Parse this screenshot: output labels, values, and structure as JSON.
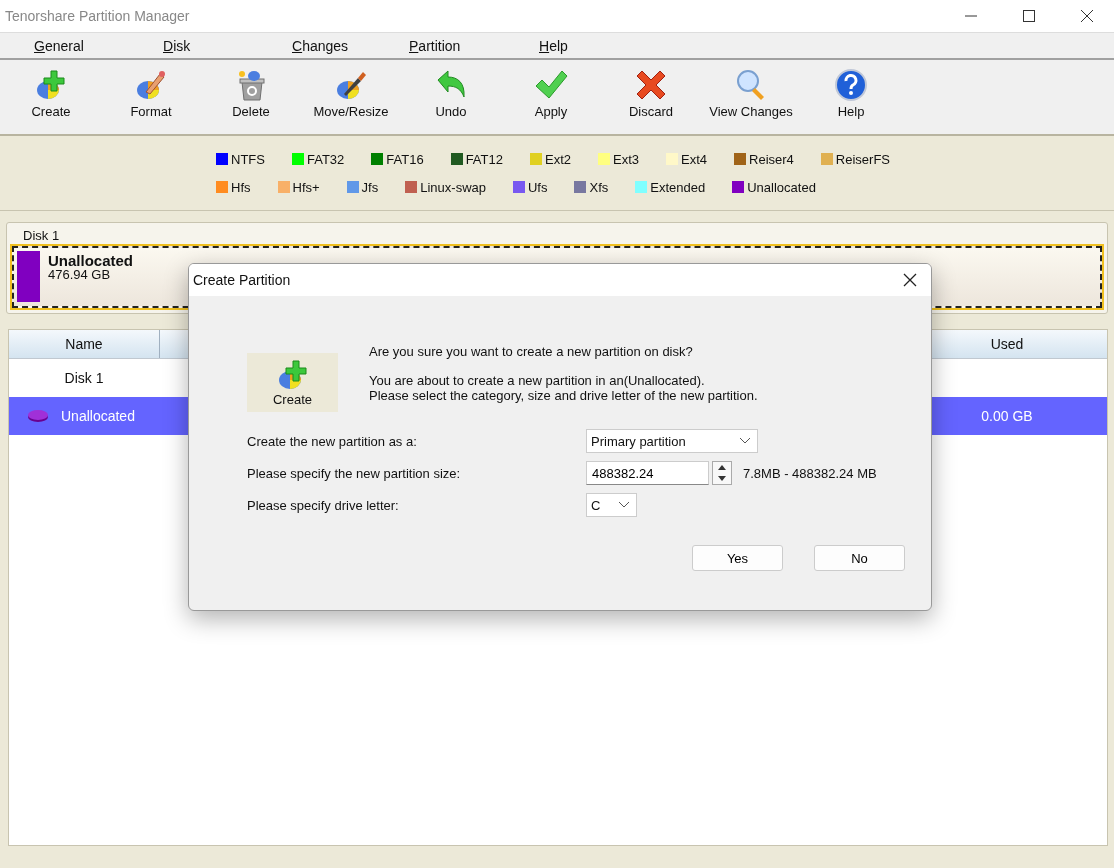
{
  "window": {
    "title": "Tenorshare Partition Manager"
  },
  "menu": [
    "General",
    "Disk",
    "Changes",
    "Partition",
    "Help"
  ],
  "toolbar": [
    {
      "label": "Create",
      "kind": "create"
    },
    {
      "label": "Format",
      "kind": "format"
    },
    {
      "label": "Delete",
      "kind": "delete"
    },
    {
      "label": "Move/Resize",
      "kind": "move"
    },
    {
      "label": "Undo",
      "kind": "undo"
    },
    {
      "label": "Apply",
      "kind": "apply"
    },
    {
      "label": "Discard",
      "kind": "discard"
    },
    {
      "label": "View Changes",
      "kind": "view"
    },
    {
      "label": "Help",
      "kind": "help"
    }
  ],
  "legend": [
    [
      {
        "label": "NTFS",
        "color": "#0000ff"
      },
      {
        "label": "FAT32",
        "color": "#00ff00"
      },
      {
        "label": "FAT16",
        "color": "#008000"
      },
      {
        "label": "FAT12",
        "color": "#215a21"
      },
      {
        "label": "Ext2",
        "color": "#e0d020"
      },
      {
        "label": "Ext3",
        "color": "#ffff80"
      },
      {
        "label": "Ext4",
        "color": "#fff8c8"
      },
      {
        "label": "Reiser4",
        "color": "#a06418"
      },
      {
        "label": "ReiserFS",
        "color": "#e0b050"
      }
    ],
    [
      {
        "label": "Hfs",
        "color": "#ff8c20"
      },
      {
        "label": "Hfs+",
        "color": "#f8b068"
      },
      {
        "label": "Jfs",
        "color": "#6098e8"
      },
      {
        "label": "Linux-swap",
        "color": "#c06050"
      },
      {
        "label": "Ufs",
        "color": "#7858f0"
      },
      {
        "label": "Xfs",
        "color": "#7878a0"
      },
      {
        "label": "Extended",
        "color": "#80ffff"
      },
      {
        "label": "Unallocated",
        "color": "#8000c0"
      }
    ]
  ],
  "disk_map": {
    "label": "Disk 1",
    "partitions": [
      {
        "name": "Unallocated",
        "size": "476.94 GB",
        "color": "#8000c0",
        "selected": true
      }
    ]
  },
  "table": {
    "columns": [
      "Name",
      "Used"
    ],
    "rows": [
      {
        "name": "Disk 1",
        "used": "",
        "kind": "disk",
        "selected": false
      },
      {
        "name": "Unallocated",
        "used": "0.00 GB",
        "kind": "partition",
        "selected": true
      }
    ]
  },
  "dialog": {
    "title": "Create Partition",
    "action": "Create",
    "question": "Are you sure you want to create a new partition on disk?",
    "info": [
      "You are about to create a new partition in an(Unallocated).",
      "Please select the category, size and drive letter of the new partition."
    ],
    "type_label": "Create the new partition as a:",
    "type_value": "Primary partition",
    "size_label": "Please specify the new partition size:",
    "size_value": "488382.24",
    "size_range": "7.8MB - 488382.24 MB",
    "letter_label": "Please specify drive letter:",
    "letter_value": "C",
    "buttons": [
      "Yes",
      "No"
    ]
  }
}
